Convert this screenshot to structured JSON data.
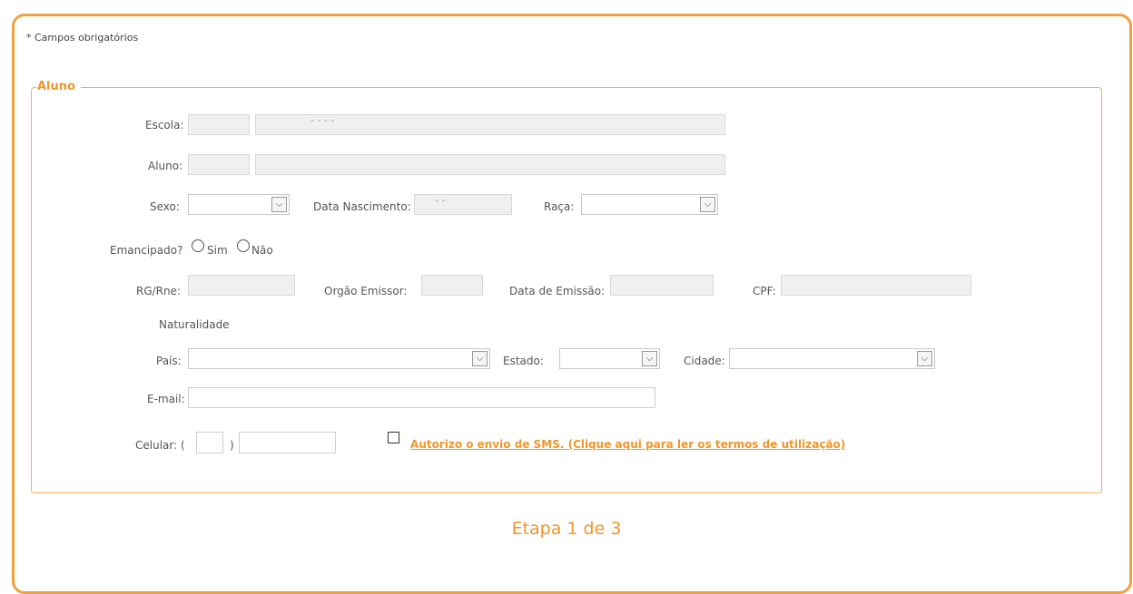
{
  "form": {
    "required_note": "* Campos obrigatórios",
    "section_title": "Aluno",
    "escola_label": "Escola:",
    "aluno_label": "Aluno:",
    "sexo_label": "Sexo:",
    "nascimento_label": "Data Nascimento:",
    "raca_label": "Raça:",
    "emancipado_label": "Emancipado?",
    "sim_label": "Sim",
    "nao_label": "Não",
    "rg_label": "RG/Rne:",
    "orgao_label": "Orgão Emissor:",
    "emissao_label": "Data de Emissão:",
    "cpf_label": "CPF:",
    "naturalidade_label": "Naturalidade",
    "pais_label": "País:",
    "estado_label": "Estado:",
    "cidade_label": "Cidade:",
    "email_label": "E-mail:",
    "celular_label": "Celular: (",
    "celular_close": ")",
    "sms_link": "Autorizo o envio de SMS. (Clique aqui para ler os termos de utilização)",
    "escola_name_value": "-            -                              -       -",
    "nascimento_value": "-   -"
  },
  "footer": {
    "step": "Etapa 1 de 3"
  },
  "colors": {
    "accent": "#f0962b",
    "border": "#f0a040"
  }
}
